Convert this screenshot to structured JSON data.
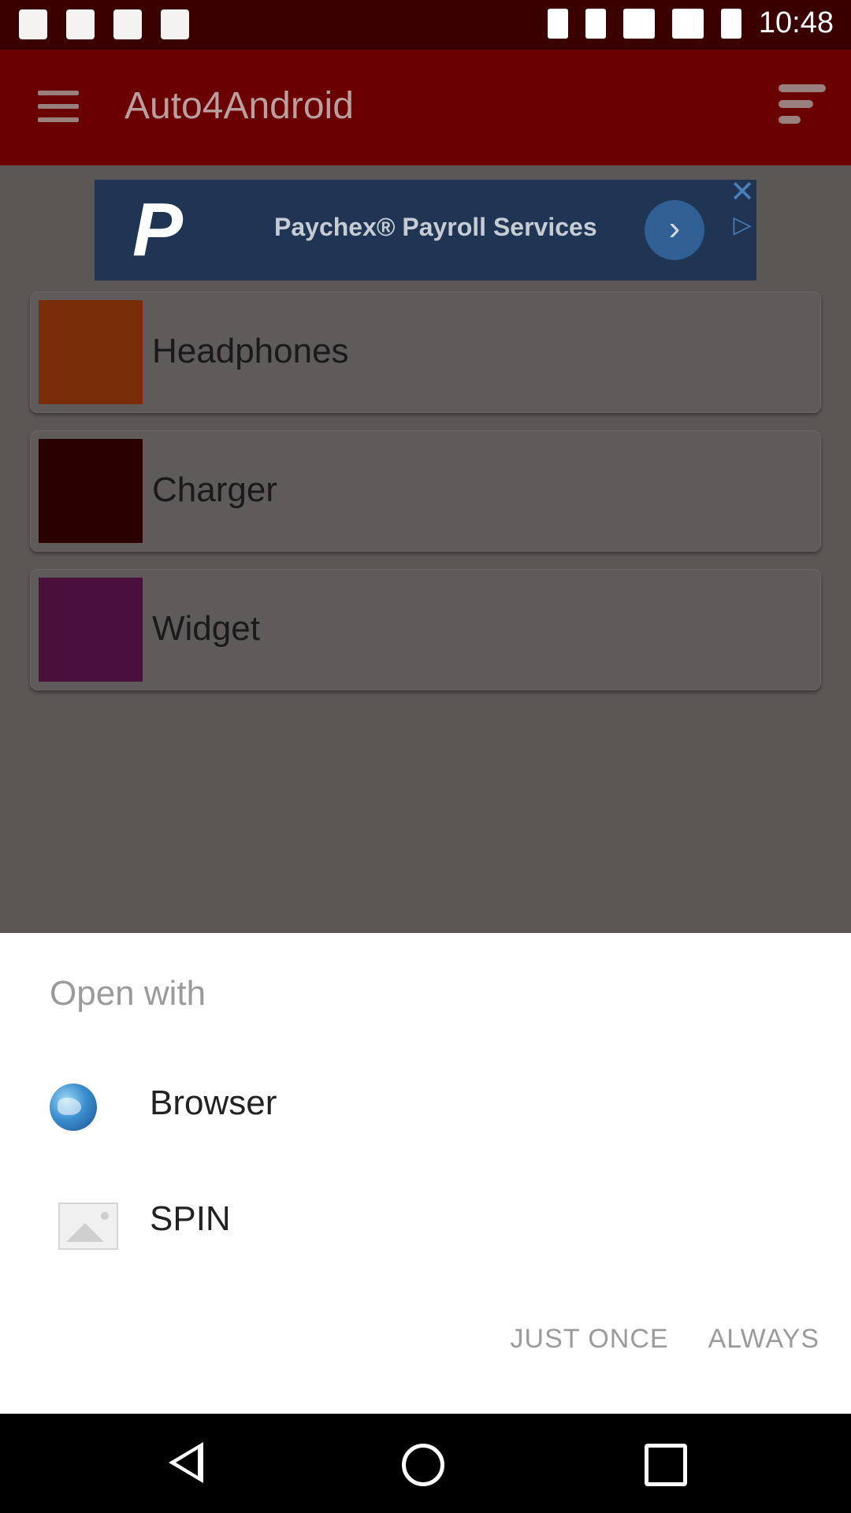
{
  "status_bar": {
    "time": "10:48",
    "left_icons": [
      "fake-gps-icon",
      "image-icon",
      "sd-card-icon",
      "clipboard-icon"
    ],
    "right_icons": [
      "bluetooth-icon",
      "vibrate-icon",
      "wifi-icon",
      "signal-icon",
      "battery-icon"
    ]
  },
  "app_bar": {
    "title": "Auto4Android",
    "menu_icon": "hamburger-icon",
    "sort_icon": "sort-icon"
  },
  "ad": {
    "logo_letter": "P",
    "text": "Paychex® Payroll Services"
  },
  "list": {
    "items": [
      {
        "label": "Headphones",
        "color": "#7a2e07"
      },
      {
        "label": "Charger",
        "color": "#2a0000"
      },
      {
        "label": "Widget",
        "color": "#4a0f3a"
      }
    ]
  },
  "sheet": {
    "title": "Open with",
    "apps": [
      {
        "label": "Browser",
        "icon": "globe-icon"
      },
      {
        "label": "SPIN",
        "icon": "image-placeholder-icon"
      }
    ],
    "buttons": {
      "just_once": "JUST ONCE",
      "always": "ALWAYS"
    }
  },
  "nav_bar": {
    "icons": [
      "back-icon",
      "home-icon",
      "recent-apps-icon"
    ]
  },
  "colors": {
    "app_bar": "#6a0000",
    "status_bar": "#3a0000",
    "scrim_content": "#5b5755",
    "sheet_bg": "#ffffff",
    "muted_text": "#9b9b9b"
  }
}
